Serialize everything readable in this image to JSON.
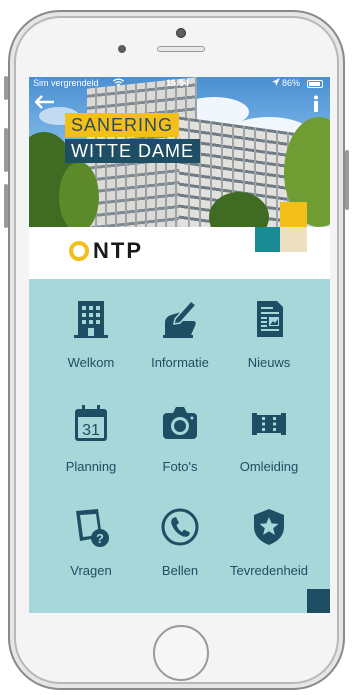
{
  "status_bar": {
    "carrier": "Sim vergrendeld",
    "time": "15:54",
    "battery": "86%"
  },
  "hero": {
    "title_line1": "SANERING",
    "title_line2": "WITTE DAME"
  },
  "logo": {
    "text": "NTP"
  },
  "colors": {
    "accent_yellow": "#f2c018",
    "dark_teal": "#1e4e63",
    "background_teal": "#a7d7d9"
  },
  "menu": [
    {
      "label": "Welkom",
      "icon": "building-icon"
    },
    {
      "label": "Informatie",
      "icon": "hand-pen-icon"
    },
    {
      "label": "Nieuws",
      "icon": "newspaper-icon"
    },
    {
      "label": "Planning",
      "icon": "calendar-icon",
      "icon_text": "31"
    },
    {
      "label": "Foto's",
      "icon": "camera-icon"
    },
    {
      "label": "Omleiding",
      "icon": "road-barrier-icon"
    },
    {
      "label": "Vragen",
      "icon": "question-note-icon"
    },
    {
      "label": "Bellen",
      "icon": "phone-icon"
    },
    {
      "label": "Tevredenheid",
      "icon": "shield-star-icon"
    }
  ]
}
